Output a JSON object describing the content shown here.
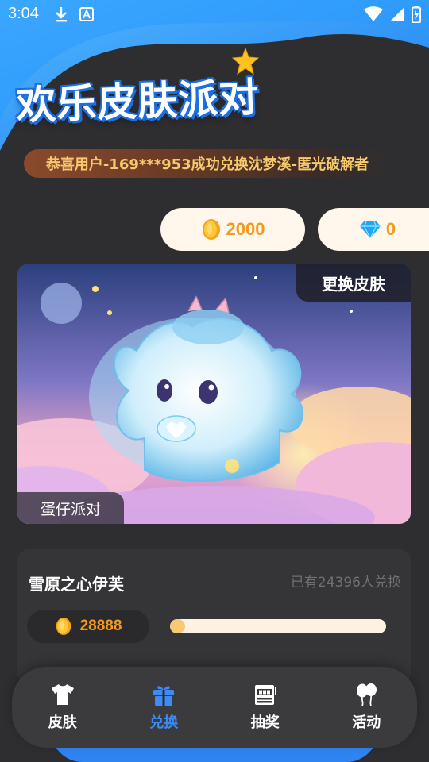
{
  "status_bar": {
    "time": "3:04",
    "left_icons": [
      "download-icon",
      "a-icon"
    ],
    "right_icons": [
      "wifi-icon",
      "signal-icon",
      "battery-icon"
    ]
  },
  "header": {
    "title": "欢乐皮肤派对"
  },
  "notice": {
    "text": "恭喜用户-169***953成功兑换沈梦溪-匿光破解者"
  },
  "balances": {
    "coins": "2000",
    "gems": "0"
  },
  "banner": {
    "change_button": "更换皮肤",
    "tag": "蛋仔派对"
  },
  "skin": {
    "name": "雪原之心伊芙",
    "redeem_count": "已有24396人兑换",
    "price": "28888",
    "progress": 0.07
  },
  "nav": {
    "items": [
      {
        "label": "皮肤",
        "icon": "shirt-icon"
      },
      {
        "label": "兑换",
        "icon": "gift-icon",
        "active": true
      },
      {
        "label": "抽奖",
        "icon": "slot-machine-icon"
      },
      {
        "label": "活动",
        "icon": "balloons-icon"
      }
    ]
  },
  "colors": {
    "accent_blue": "#3d8cf5",
    "coin_orange": "#f39a1c",
    "background": "#2e2e30",
    "notice_text": "#f7c96d"
  }
}
